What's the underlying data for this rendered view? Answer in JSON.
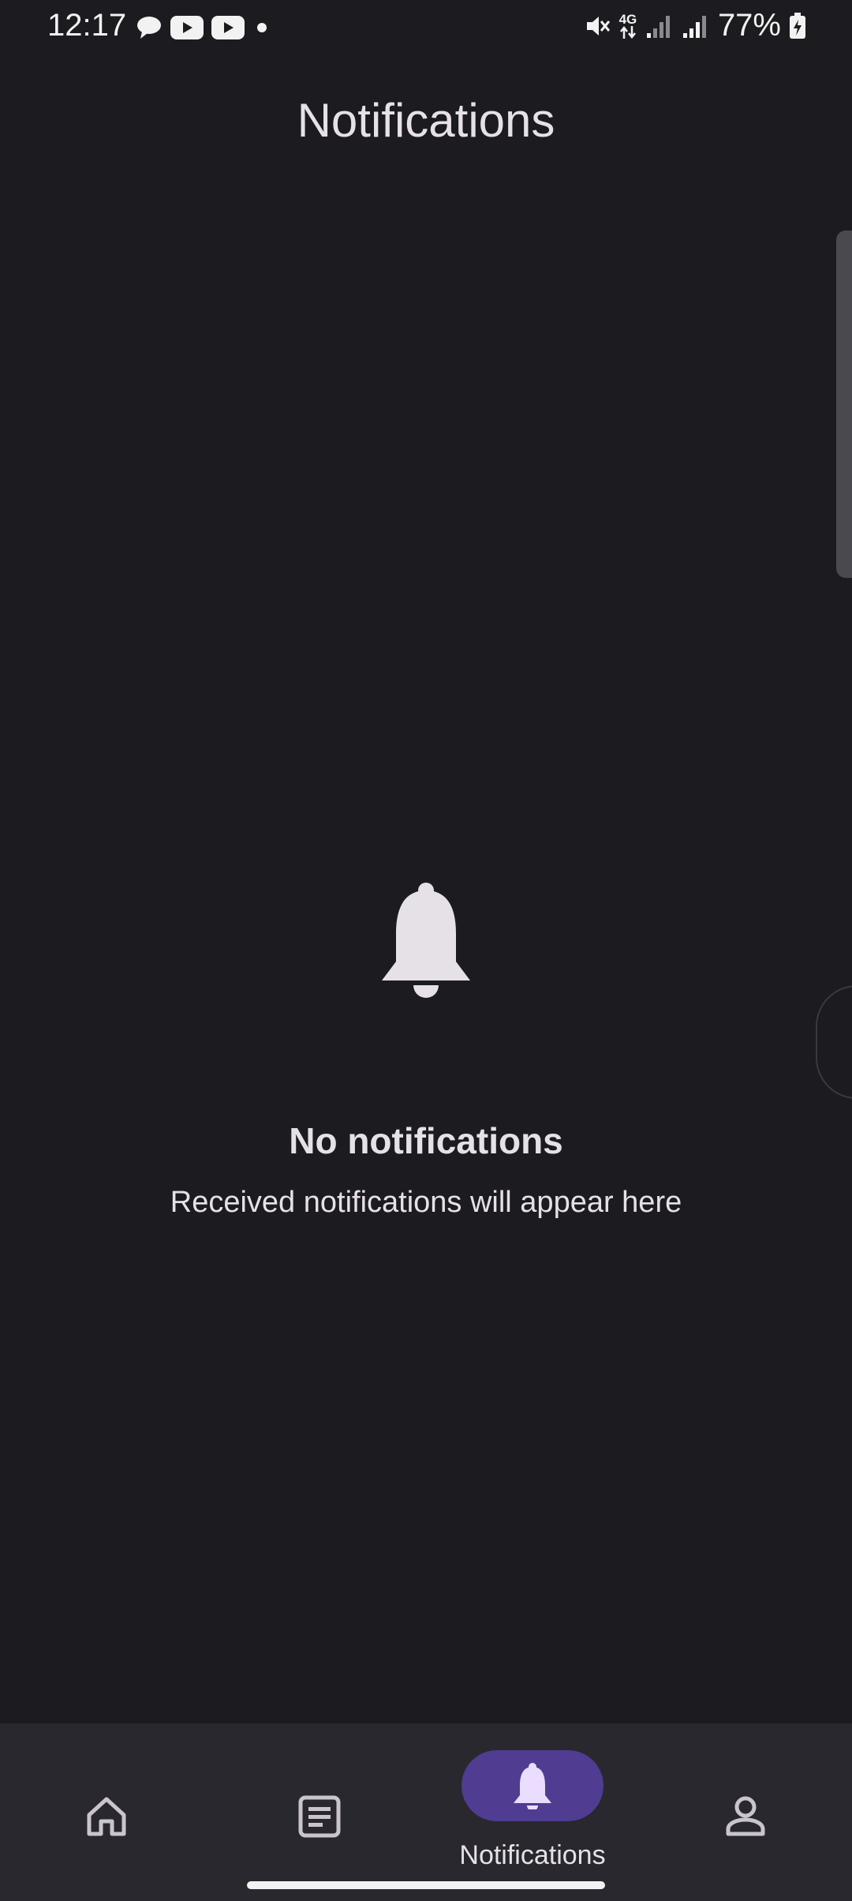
{
  "status_bar": {
    "time": "12:17",
    "network": "4G",
    "battery": "77%",
    "icons": [
      "chat-bubble-icon",
      "youtube-icon",
      "youtube-icon",
      "dot-icon",
      "mute-icon",
      "network-4g-icon",
      "signal-icon",
      "signal-icon",
      "battery-charging-icon"
    ]
  },
  "header": {
    "title": "Notifications"
  },
  "empty_state": {
    "icon": "bell-icon",
    "title": "No notifications",
    "subtitle": "Received notifications will appear here"
  },
  "bottom_nav": {
    "items": [
      {
        "icon": "home-icon",
        "label": ""
      },
      {
        "icon": "feed-icon",
        "label": ""
      },
      {
        "icon": "bell-icon",
        "label": "Notifications",
        "selected": true
      },
      {
        "icon": "profile-icon",
        "label": ""
      }
    ],
    "selected_color": "#503c90"
  },
  "colors": {
    "background": "#1c1b20",
    "nav_background": "#29282f",
    "text": "#e6e1e6"
  }
}
